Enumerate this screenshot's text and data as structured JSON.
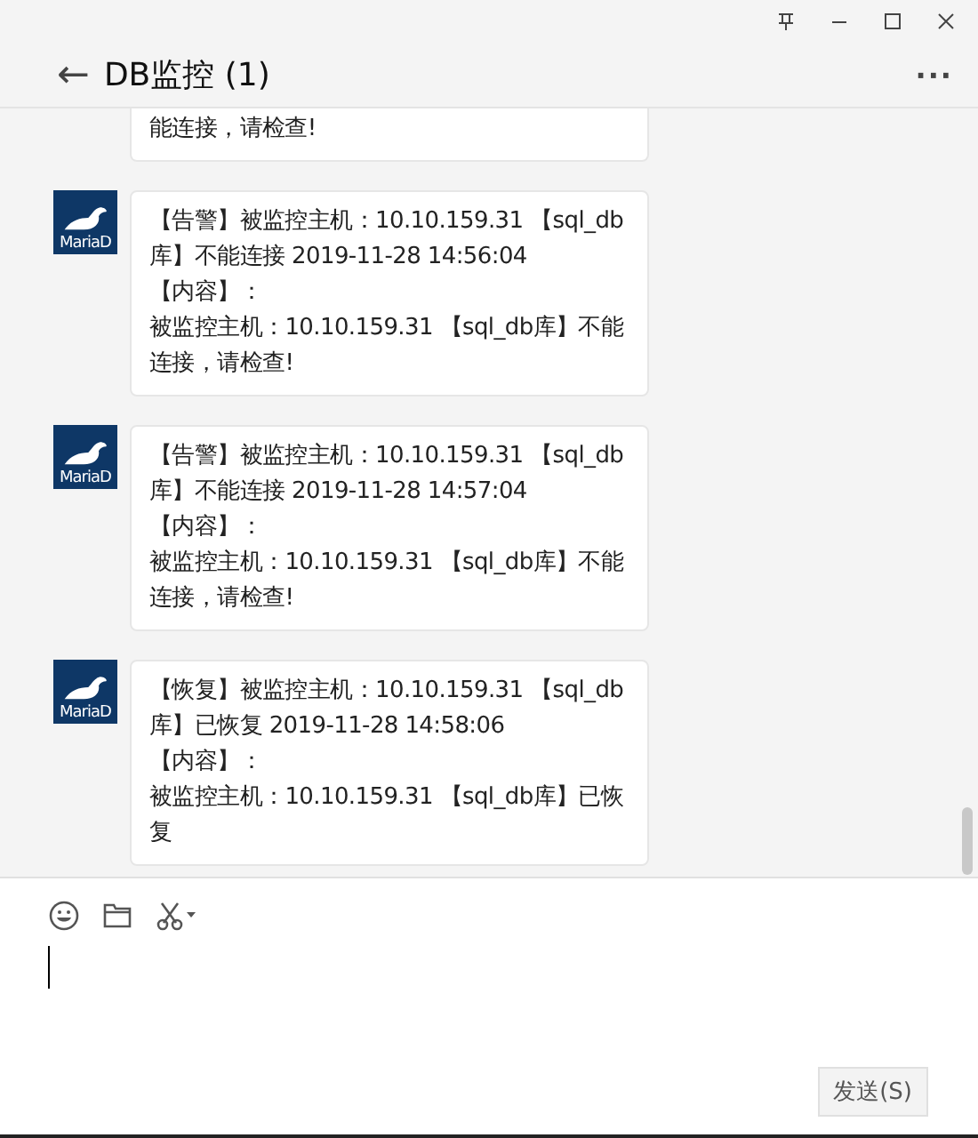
{
  "header": {
    "back": "←",
    "title": "DB监控 (1)",
    "more": "···"
  },
  "messages": [
    {
      "partial": true,
      "content": "能连接，请检查!"
    },
    {
      "partial": false,
      "avatar_label": "MariaD",
      "alert": "【告警】被监控主机：10.10.159.31 【sql_db库】不能连接 2019-11-28 14:56:04",
      "content_label": "【内容】：",
      "content": "被监控主机：10.10.159.31 【sql_db库】不能连接，请检查!"
    },
    {
      "partial": false,
      "avatar_label": "MariaD",
      "alert": "【告警】被监控主机：10.10.159.31 【sql_db库】不能连接 2019-11-28 14:57:04",
      "content_label": "【内容】：",
      "content": "被监控主机：10.10.159.31 【sql_db库】不能连接，请检查!"
    },
    {
      "partial": false,
      "avatar_label": "MariaD",
      "alert": "【恢复】被监控主机：10.10.159.31 【sql_db库】已恢复 2019-11-28 14:58:06",
      "content_label": "【内容】：",
      "content": "被监控主机：10.10.159.31 【sql_db库】已恢复"
    }
  ],
  "send_button": "发送(S)"
}
